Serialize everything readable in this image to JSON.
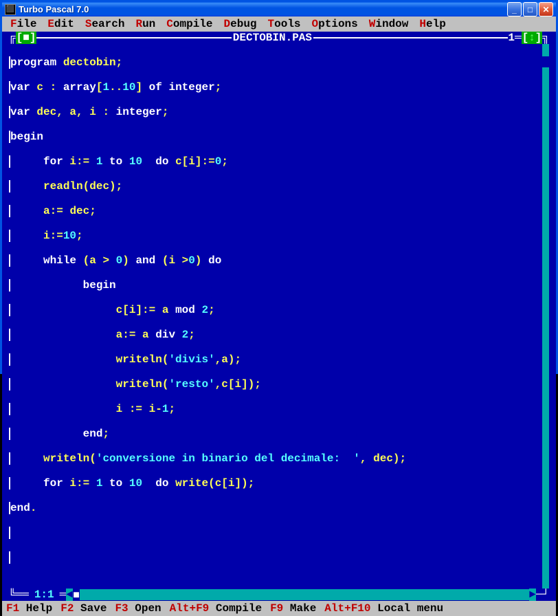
{
  "window": {
    "title": "Turbo Pascal 7.0"
  },
  "menu": {
    "file": "File",
    "edit": "Edit",
    "search": "Search",
    "run": "Run",
    "compile": "Compile",
    "debug": "Debug",
    "tools": "Tools",
    "options": "Options",
    "window": "Window",
    "help": "Help"
  },
  "editor": {
    "filename": "DECTOBIN.PAS",
    "window_number": "1",
    "cursor_pos": "1:1"
  },
  "code": {
    "l1_kw1": "program",
    "l1_id1": " dectobin",
    "l1_p1": ";",
    "l2_kw1": "var",
    "l2_id1": " c ",
    "l2_p1": ": ",
    "l2_kw2": "array",
    "l2_p2": "[",
    "l2_n1": "1",
    "l2_p3": "..",
    "l2_n2": "10",
    "l2_p4": "] ",
    "l2_kw3": "of",
    "l2_kw4": " integer",
    "l2_p5": ";",
    "l3_kw1": "var",
    "l3_id1": " dec",
    "l3_p1": ", ",
    "l3_id2": "a",
    "l3_p2": ", ",
    "l3_id3": "i ",
    "l3_p3": ": ",
    "l3_kw2": "integer",
    "l3_p4": ";",
    "l4_kw1": "begin",
    "l5_sp": "     ",
    "l5_kw1": "for",
    "l5_id1": " i",
    "l5_p1": ":= ",
    "l5_n1": "1",
    "l5_kw2": " to ",
    "l5_n2": "10",
    "l5_kw3": "  do",
    "l5_id2": " c",
    "l5_p2": "[",
    "l5_id3": "i",
    "l5_p3": "]:=",
    "l5_n3": "0",
    "l5_p4": ";",
    "l6_sp": "     ",
    "l6_id1": "readln",
    "l6_p1": "(",
    "l6_id2": "dec",
    "l6_p2": ");",
    "l7_sp": "     ",
    "l7_id1": "a",
    "l7_p1": ":= ",
    "l7_id2": "dec",
    "l7_p2": ";",
    "l8_sp": "     ",
    "l8_id1": "i",
    "l8_p1": ":=",
    "l8_n1": "10",
    "l8_p2": ";",
    "l9_sp": "     ",
    "l9_kw1": "while",
    "l9_p1": " (",
    "l9_id1": "a ",
    "l9_p2": "> ",
    "l9_n1": "0",
    "l9_p3": ") ",
    "l9_kw2": "and",
    "l9_p4": " (",
    "l9_id2": "i ",
    "l9_p5": ">",
    "l9_n2": "0",
    "l9_p6": ") ",
    "l9_kw3": "do",
    "l10_sp": "           ",
    "l10_kw1": "begin",
    "l11_sp": "                ",
    "l11_id1": "c",
    "l11_p1": "[",
    "l11_id2": "i",
    "l11_p2": "]:= ",
    "l11_id3": "a ",
    "l11_kw1": "mod ",
    "l11_n1": "2",
    "l11_p3": ";",
    "l12_sp": "                ",
    "l12_id1": "a",
    "l12_p1": ":= ",
    "l12_id2": "a ",
    "l12_kw1": "div ",
    "l12_n1": "2",
    "l12_p2": ";",
    "l13_sp": "                ",
    "l13_id1": "writeln",
    "l13_p1": "(",
    "l13_s1": "'divis'",
    "l13_p2": ",",
    "l13_id2": "a",
    "l13_p3": ");",
    "l14_sp": "                ",
    "l14_id1": "writeln",
    "l14_p1": "(",
    "l14_s1": "'resto'",
    "l14_p2": ",",
    "l14_id2": "c",
    "l14_p3": "[",
    "l14_id3": "i",
    "l14_p4": "]);",
    "l15_sp": "                ",
    "l15_id1": "i ",
    "l15_p1": ":= ",
    "l15_id2": "i",
    "l15_p2": "-",
    "l15_n1": "1",
    "l15_p3": ";",
    "l16_sp": "           ",
    "l16_kw1": "end",
    "l16_p1": ";",
    "l17_sp": "     ",
    "l17_id1": "writeln",
    "l17_p1": "(",
    "l17_s1": "'conversione in binario del decimale:  '",
    "l17_p2": ", ",
    "l17_id2": "dec",
    "l17_p3": ");",
    "l18_sp": "     ",
    "l18_kw1": "for",
    "l18_id1": " i",
    "l18_p1": ":= ",
    "l18_n1": "1",
    "l18_kw2": " to ",
    "l18_n2": "10",
    "l18_kw3": "  do",
    "l18_id2": " write",
    "l18_p2": "(",
    "l18_id3": "c",
    "l18_p3": "[",
    "l18_id4": "i",
    "l18_p4": "]);",
    "l19_kw1": "end",
    "l19_p1": "."
  },
  "status": {
    "f1_key": "F1",
    "f1_label": " Help",
    "f2_key": "F2",
    "f2_label": " Save",
    "f3_key": "F3",
    "f3_label": " Open",
    "af9_key": "Alt+F9",
    "af9_label": " Compile",
    "f9_key": "F9",
    "f9_label": " Make",
    "af10_key": "Alt+F10",
    "af10_label": " Local menu"
  }
}
